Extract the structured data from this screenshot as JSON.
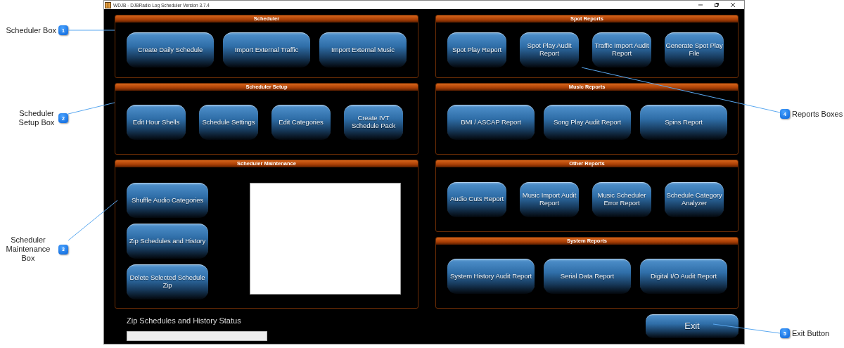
{
  "left_callouts": [
    {
      "number": "1",
      "label": "Scheduler Box"
    },
    {
      "number": "2",
      "label": "Scheduler Setup Box"
    },
    {
      "number": "3",
      "label": "Scheduler Maintenance Box"
    }
  ],
  "right_callouts": [
    {
      "number": "4",
      "label": "Reports Boxes"
    },
    {
      "number": "5",
      "label": "Exit Button"
    }
  ],
  "window": {
    "title": "WDJB - DJBRadio Log Scheduler Version 3.7.4"
  },
  "left_sections": [
    {
      "title": "Scheduler",
      "kind": "buttons",
      "buttons": [
        "Create Daily Schedule",
        "Import External Traffic",
        "Import External Music"
      ]
    },
    {
      "title": "Scheduler Setup",
      "kind": "buttons",
      "buttons": [
        "Edit Hour Shells",
        "Schedule Settings",
        "Edit Categories",
        "Create IVT Schedule Pack"
      ]
    },
    {
      "title": "Scheduler Maintenance",
      "kind": "maintenance",
      "buttons": [
        "Shuffle Audio Categories",
        "Zip Schedules and History",
        "Delete Selected Schedule Zip"
      ]
    }
  ],
  "right_sections": [
    {
      "title": "Spot Reports",
      "kind": "buttons",
      "buttons": [
        "Spot Play Report",
        "Spot Play Audit Report",
        "Traffic Import Audit Report",
        "Generate Spot Play File"
      ]
    },
    {
      "title": "Music Reports",
      "kind": "buttons",
      "buttons": [
        "BMI / ASCAP Report",
        "Song Play Audit Report",
        "Spins Report"
      ]
    },
    {
      "title": "Other Reports",
      "kind": "buttons",
      "buttons": [
        "Audio Cuts Report",
        "Music Import Audit Report",
        "Music Scheduler Error Report",
        "Schedule Category Analyzer"
      ]
    },
    {
      "title": "System Reports",
      "kind": "buttons",
      "buttons": [
        "System History Audit Report",
        "Serial Data Report",
        "Digital I/O Audit Report"
      ]
    }
  ],
  "status": {
    "label": "Zip Schedules and History Status",
    "level": 0
  },
  "exit_button": "Exit"
}
